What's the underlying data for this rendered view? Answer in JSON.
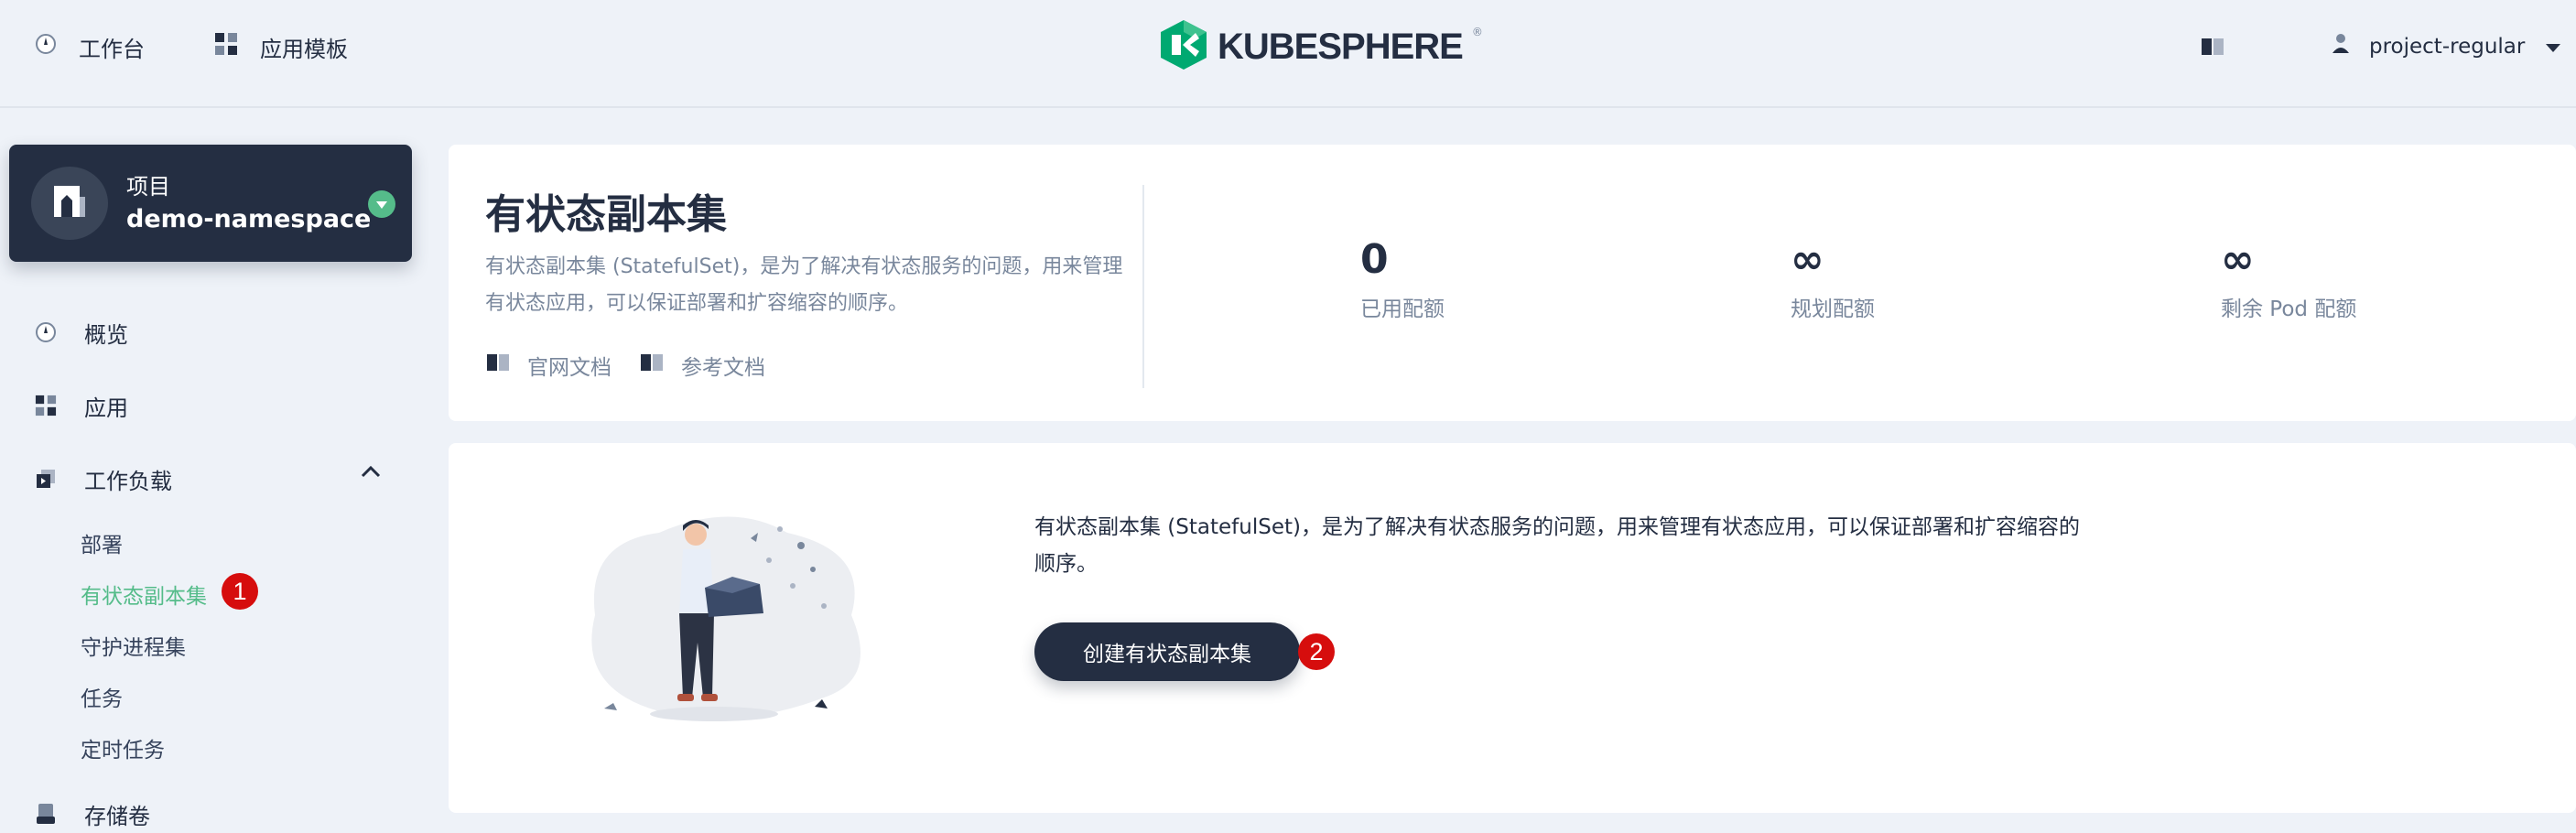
{
  "topnav": {
    "workbench_label": "工作台",
    "templates_label": "应用模板",
    "logo_text": "KUBESPHERE",
    "logo_mark": "®",
    "username": "project-regular"
  },
  "sidebar": {
    "project_label": "项目",
    "project_name": "demo-namespace",
    "items": [
      {
        "label": "概览",
        "icon": "dashboard-icon"
      },
      {
        "label": "应用",
        "icon": "apps-icon"
      },
      {
        "label": "工作负载",
        "icon": "workload-icon"
      },
      {
        "label": "存储卷",
        "icon": "storage-icon"
      }
    ],
    "workload_children": [
      "部署",
      "有状态副本集",
      "守护进程集",
      "任务",
      "定时任务"
    ],
    "active_child": "有状态副本集",
    "step_badge_1": "1"
  },
  "header": {
    "title": "有状态副本集",
    "description": "有状态副本集 (StatefulSet)，是为了解决有状态服务的问题，用来管理有状态应用，可以保证部署和扩容缩容的顺序。",
    "doc_links": [
      "官网文档",
      "参考文档"
    ],
    "quotas": [
      {
        "value": "0",
        "label": "已用配额"
      },
      {
        "value": "∞",
        "label": "规划配额"
      },
      {
        "value": "∞",
        "label": "剩余 Pod 配额"
      }
    ]
  },
  "empty_state": {
    "description": "有状态副本集 (StatefulSet)，是为了解决有状态服务的问题，用来管理有状态应用，可以保证部署和扩容缩容的顺序。",
    "create_button": "创建有状态副本集",
    "step_badge_2": "2"
  },
  "colors": {
    "accent_green": "#55bc8a",
    "dark": "#242e42",
    "muted": "#79879c",
    "badge_red": "#d60d0d",
    "background": "#eef2f8"
  }
}
